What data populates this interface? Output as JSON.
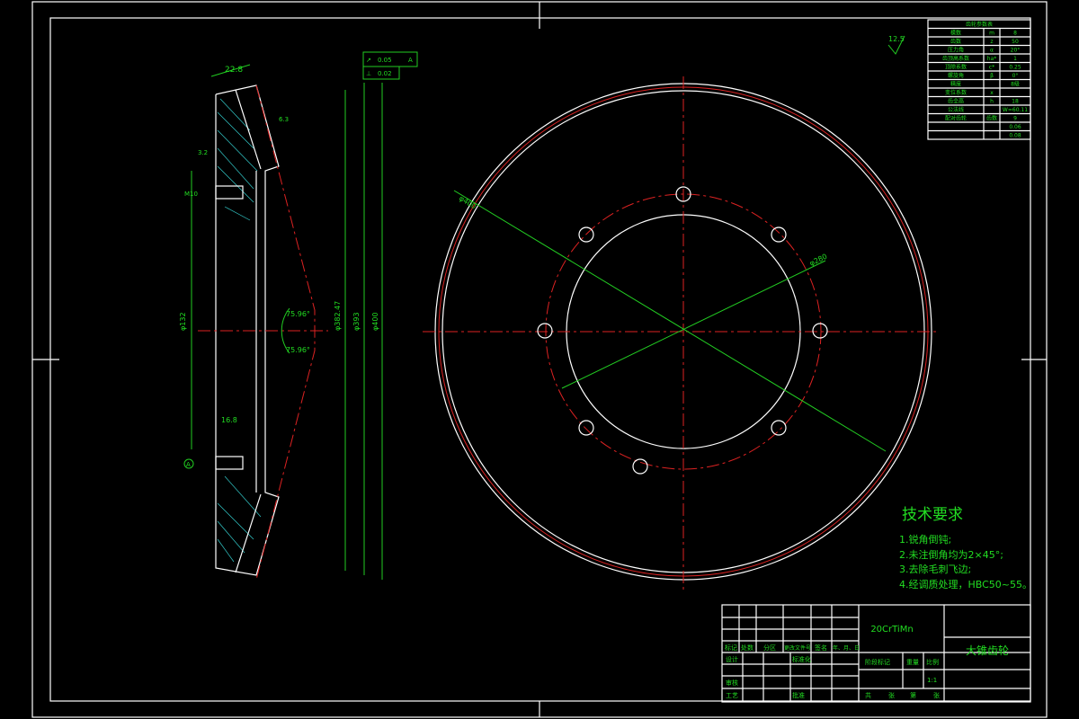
{
  "tech_requirements": {
    "title": "技术要求",
    "items": [
      "1.锐角倒钝;",
      "2.未注倒角均为2×45°;",
      "3.去除毛刺飞边;",
      "4.经调质处理，HBC50~55。"
    ]
  },
  "roughness_symbol": "12.5",
  "section_view": {
    "dims": [
      "22.8",
      "3.2",
      "6.3",
      "M10",
      "16.8",
      "75.96°",
      "75.96°",
      "φ132",
      "φ382.47",
      "φ393",
      "φ400"
    ],
    "tolerance_frame": [
      [
        "↗",
        "0.05",
        "A"
      ],
      [
        "⊥",
        "0.02"
      ]
    ],
    "datum": "A"
  },
  "circle_view": {
    "dims": [
      "φ400",
      "φ280"
    ]
  },
  "param_table": {
    "title": "齿轮参数表",
    "rows": [
      [
        "模数",
        "m",
        "8"
      ],
      [
        "齿数",
        "z",
        "50"
      ],
      [
        "压力角",
        "α",
        "20°"
      ],
      [
        "齿顶高系数",
        "ha*",
        "1"
      ],
      [
        "顶隙系数",
        "c*",
        "0.25"
      ],
      [
        "螺旋角",
        "β",
        "0°"
      ],
      [
        "精度",
        "",
        "8级"
      ],
      [
        "变位系数",
        "x",
        ""
      ],
      [
        "齿全高",
        "h",
        "18"
      ],
      [
        "公法线",
        "",
        "W=60.11"
      ],
      [
        "配对齿轮",
        "齿数",
        "9"
      ],
      [
        "",
        "",
        "0.06"
      ],
      [
        "",
        "",
        "0.08"
      ]
    ]
  },
  "title_block": {
    "material": "20CrTiMn",
    "part_name": "大锥齿轮",
    "headers": [
      "标记",
      "处数",
      "分区",
      "更改文件号",
      "签名",
      "年、月、日"
    ],
    "rows": [
      "设计",
      "标准化",
      "审核",
      "工艺",
      "批准"
    ],
    "stage_label": "阶段标记",
    "weight_label": "重量",
    "scale_label": "比例",
    "scale": "1:1",
    "sheet": [
      "共",
      "张",
      "第",
      "张"
    ]
  }
}
